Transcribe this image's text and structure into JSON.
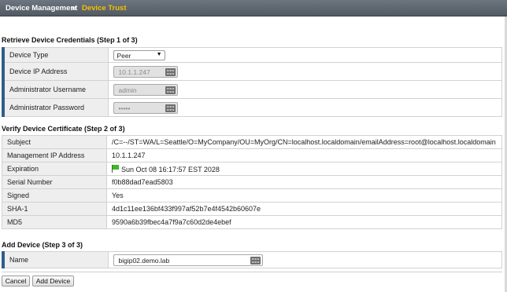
{
  "header": {
    "breadcrumb_parent": "Device Management",
    "breadcrumb_separator": "››",
    "breadcrumb_current": "Device Trust",
    "current_color": "#f4c200"
  },
  "step1": {
    "title": "Retrieve Device Credentials (Step 1 of 3)",
    "device_type_label": "Device Type",
    "device_type_value": "Peer",
    "ip_label": "Device IP Address",
    "ip_value": "10.1.1.247",
    "username_label": "Administrator Username",
    "username_value": "admin",
    "password_label": "Administrator Password",
    "password_value": "•••••"
  },
  "step2": {
    "title": "Verify Device Certificate (Step 2 of 3)",
    "rows": [
      {
        "label": "Subject",
        "value": "/C=--/ST=WA/L=Seattle/O=MyCompany/OU=MyOrg/CN=localhost.localdomain/emailAddress=root@localhost.localdomain"
      },
      {
        "label": "Management IP Address",
        "value": "10.1.1.247"
      },
      {
        "label": "Expiration",
        "value": "Sun Oct 08 16:17:57 EST 2028"
      },
      {
        "label": "Serial Number",
        "value": "f0b88dad7ead5803"
      },
      {
        "label": "Signed",
        "value": "Yes"
      },
      {
        "label": "SHA-1",
        "value": "4d1c11ee136bf433f997af52b7e4f4542b60607e"
      },
      {
        "label": "MD5",
        "value": "9590a6b39fbec4a7f9a7c60d2de4ebef"
      }
    ]
  },
  "step3": {
    "title": "Add Device (Step 3 of 3)",
    "name_label": "Name",
    "name_value": "bigip02.demo.lab"
  },
  "buttons": {
    "cancel_label": "Cancel",
    "add_label": "Add Device"
  },
  "icons": {
    "input_icon": "keyboard-icon",
    "expiration_icon": "green-flag-icon",
    "select_icon": "chevron-down-icon"
  }
}
